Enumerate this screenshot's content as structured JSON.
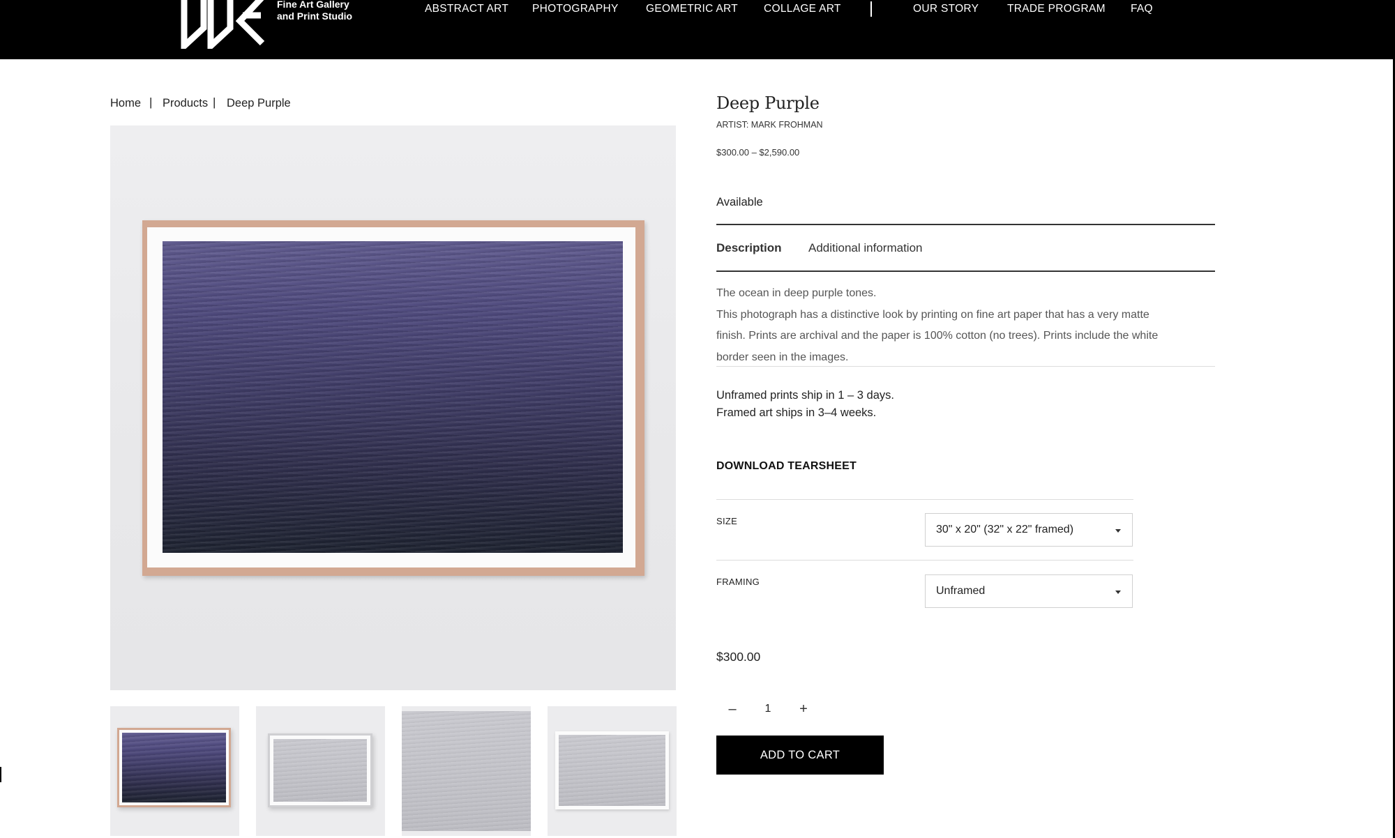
{
  "brand": {
    "logo_letters": "DDE",
    "tagline_line1": "Fine Art Gallery",
    "tagline_line2": "and Print Studio"
  },
  "nav": {
    "items": [
      "ABSTRACT ART",
      "PHOTOGRAPHY",
      "GEOMETRIC ART",
      "COLLAGE ART",
      "OUR STORY",
      "TRADE PROGRAM",
      "FAQ"
    ]
  },
  "breadcrumb": {
    "items": [
      "Home",
      "Products",
      "Deep Purple"
    ],
    "separator": "|"
  },
  "product": {
    "title": "Deep Purple",
    "artist": "ARTIST: MARK FROHMAN",
    "price_range": "$300.00 – $2,590.00",
    "availability": "Available",
    "tabs": [
      "Description",
      "Additional information"
    ],
    "active_tab": "Description",
    "description": [
      "The ocean in deep purple tones.",
      "This photograph has a distinctive look by printing on fine art paper that has a very matte",
      "finish. Prints are archival and the paper is 100% cotton (no trees). Prints include the white",
      "border seen in the images."
    ],
    "shipping": [
      "Unframed prints ship in 1 – 3 days.",
      "Framed art ships in 3–4 weeks."
    ],
    "tearsheet_label": "DOWNLOAD TEARSHEET",
    "options": {
      "size": {
        "label": "SIZE",
        "value": "30\" x 20\" (32\" x 22\" framed)"
      },
      "framing": {
        "label": "FRAMING",
        "value": "Unframed"
      }
    },
    "price": "$300.00",
    "quantity": {
      "minus": "–",
      "value": "1",
      "plus": "+"
    },
    "add_to_cart": "ADD TO CART"
  },
  "colors": {
    "header_bg": "#000000",
    "button_bg": "#000000",
    "frame_wood": "#d2a892",
    "photo_purple": "#4f4a7e"
  }
}
